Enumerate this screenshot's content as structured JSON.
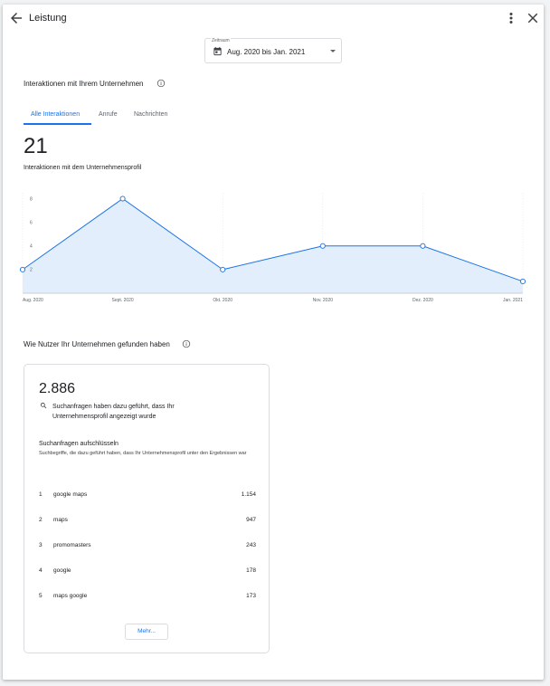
{
  "header": {
    "title": "Leistung",
    "icons": {
      "back": "arrow-back-icon",
      "more": "more-vert-icon",
      "close": "close-icon"
    }
  },
  "date_range": {
    "label": "Zeitraum",
    "value": "Aug. 2020 bis Jan. 2021"
  },
  "interactions": {
    "section_title": "Interaktionen mit Ihrem Unternehmen",
    "tabs": [
      {
        "label": "Alle Interaktionen",
        "active": true
      },
      {
        "label": "Anrufe",
        "active": false
      },
      {
        "label": "Nachrichten",
        "active": false
      }
    ],
    "total": "21",
    "total_label": "Interaktionen mit dem Unternehmensprofil"
  },
  "chart_data": {
    "type": "area",
    "categories": [
      "Aug. 2020",
      "Sept. 2020",
      "Okt. 2020",
      "Nov. 2020",
      "Dez. 2020",
      "Jan. 2021"
    ],
    "values": [
      2,
      8,
      2,
      4,
      4,
      1
    ],
    "yticks": [
      "2",
      "4",
      "6",
      "8"
    ],
    "ylim": [
      0,
      8.5
    ],
    "colors": {
      "line": "#1a73e8",
      "fill": "#e3eefd"
    }
  },
  "discovery": {
    "section_title": "Wie Nutzer Ihr Unternehmen gefunden haben",
    "total": "2.886",
    "total_desc": "Suchanfragen haben dazu geführt, dass Ihr Unternehmensprofil angezeigt wurde",
    "breakdown_title": "Suchanfragen aufschlüsseln",
    "breakdown_sub": "Suchbegriffe, die dazu geführt haben, dass Ihr Unternehmensprofil unter den Ergebnissen war",
    "queries": [
      {
        "rank": "1",
        "term": "google maps",
        "count": "1.154"
      },
      {
        "rank": "2",
        "term": "maps",
        "count": "947"
      },
      {
        "rank": "3",
        "term": "promomasters",
        "count": "243"
      },
      {
        "rank": "4",
        "term": "google",
        "count": "178"
      },
      {
        "rank": "5",
        "term": "maps google",
        "count": "173"
      }
    ],
    "more_label": "Mehr..."
  }
}
